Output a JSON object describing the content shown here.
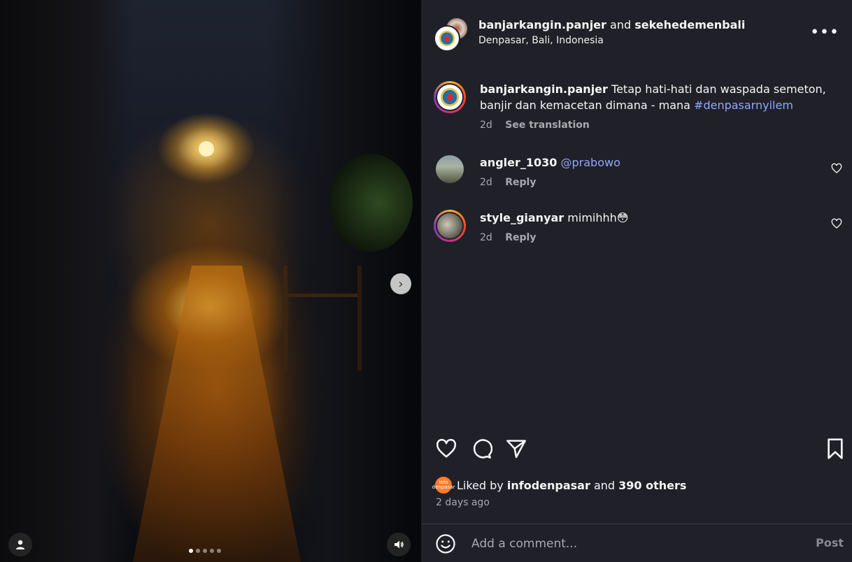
{
  "post": {
    "author": "banjarkangin.panjer",
    "joiner": "and",
    "collaborator": "sekehedemenbali",
    "location": "Denpasar, Bali, Indonesia",
    "more_label": "•••"
  },
  "media": {
    "carousel_count": 5,
    "active_index": 0,
    "next_glyph": "›",
    "icons": [
      "user-tag-icon",
      "audio-icon",
      "chevron-right-icon"
    ]
  },
  "caption": {
    "username": "banjarkangin.panjer",
    "text": "Tetap hati-hati dan waspada semeton, banjir dan kemacetan dimana - mana ",
    "hashtag": "#denpasarnyilem",
    "age": "2d",
    "translate_label": "See translation"
  },
  "comments": [
    {
      "username": "angler_1030",
      "mention": "@prabowo",
      "text": "",
      "age": "2d",
      "reply_label": "Reply"
    },
    {
      "username": "style_gianyar",
      "mention": "",
      "text": "mimihhh😳",
      "age": "2d",
      "reply_label": "Reply"
    }
  ],
  "likes": {
    "prefix": "Liked by",
    "user": "infodenpasar",
    "middle": "and",
    "others": "390 others",
    "avatar_text": "info denpasar"
  },
  "date": "2 days ago",
  "composer": {
    "placeholder": "Add a comment...",
    "post_label": "Post"
  },
  "colors": {
    "panel_bg": "#202128",
    "link": "#8fa6ff",
    "muted": "#a8a8ae"
  }
}
